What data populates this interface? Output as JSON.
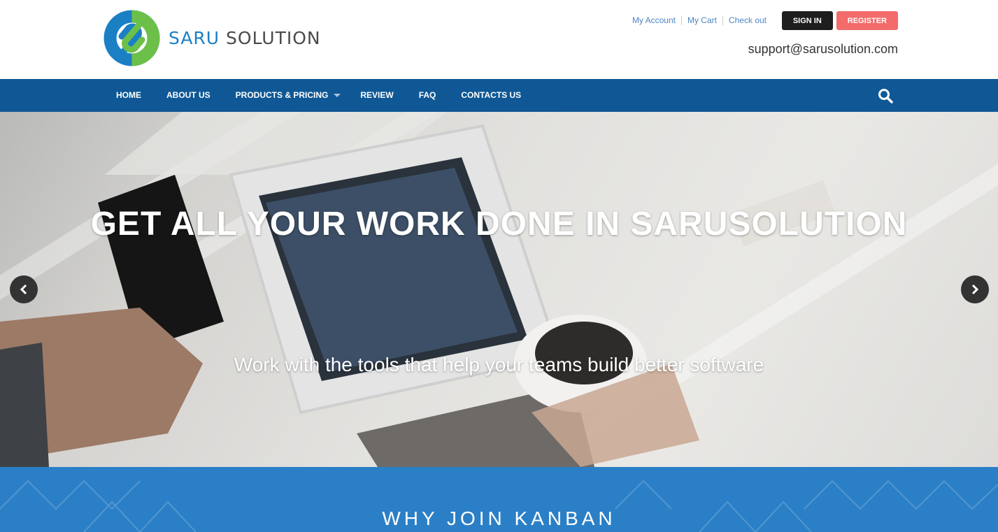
{
  "brand": {
    "part1": "SARU",
    "part2": " SOLUTION",
    "primary": "#1b7fc4",
    "secondary": "#6cc04a"
  },
  "top_links": [
    "My Account",
    "My Cart",
    "Check out"
  ],
  "auth": {
    "sign_in": "SIGN IN",
    "register": "REGISTER"
  },
  "contact_email": "support@sarusolution.com",
  "nav": {
    "items": [
      "HOME",
      "ABOUT US",
      "PRODUCTS & PRICING",
      "REVIEW",
      "FAQ",
      "CONTACTS US"
    ],
    "bg": "#0f5895"
  },
  "hero": {
    "title": "GET ALL YOUR WORK DONE IN SARUSOLUTION",
    "subtitle": "Work with the tools that help your teams build better software"
  },
  "section": {
    "title": "WHY JOIN KANBAN",
    "bg": "#2b7fc6"
  },
  "icons": [
    "logo-icon",
    "search-icon",
    "chevron-left-icon",
    "chevron-right-icon",
    "caret-down-icon"
  ]
}
